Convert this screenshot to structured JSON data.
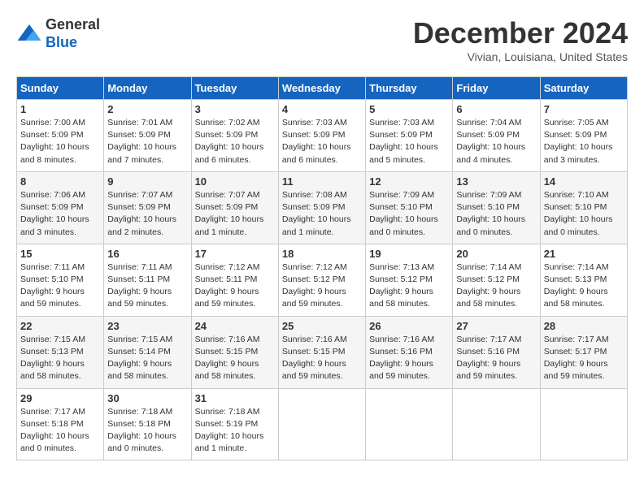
{
  "logo": {
    "general": "General",
    "blue": "Blue"
  },
  "title": "December 2024",
  "location": "Vivian, Louisiana, United States",
  "days_of_week": [
    "Sunday",
    "Monday",
    "Tuesday",
    "Wednesday",
    "Thursday",
    "Friday",
    "Saturday"
  ],
  "weeks": [
    [
      {
        "day": "1",
        "sunrise": "7:00 AM",
        "sunset": "5:09 PM",
        "daylight": "10 hours and 8 minutes."
      },
      {
        "day": "2",
        "sunrise": "7:01 AM",
        "sunset": "5:09 PM",
        "daylight": "10 hours and 7 minutes."
      },
      {
        "day": "3",
        "sunrise": "7:02 AM",
        "sunset": "5:09 PM",
        "daylight": "10 hours and 6 minutes."
      },
      {
        "day": "4",
        "sunrise": "7:03 AM",
        "sunset": "5:09 PM",
        "daylight": "10 hours and 6 minutes."
      },
      {
        "day": "5",
        "sunrise": "7:03 AM",
        "sunset": "5:09 PM",
        "daylight": "10 hours and 5 minutes."
      },
      {
        "day": "6",
        "sunrise": "7:04 AM",
        "sunset": "5:09 PM",
        "daylight": "10 hours and 4 minutes."
      },
      {
        "day": "7",
        "sunrise": "7:05 AM",
        "sunset": "5:09 PM",
        "daylight": "10 hours and 3 minutes."
      }
    ],
    [
      {
        "day": "8",
        "sunrise": "7:06 AM",
        "sunset": "5:09 PM",
        "daylight": "10 hours and 3 minutes."
      },
      {
        "day": "9",
        "sunrise": "7:07 AM",
        "sunset": "5:09 PM",
        "daylight": "10 hours and 2 minutes."
      },
      {
        "day": "10",
        "sunrise": "7:07 AM",
        "sunset": "5:09 PM",
        "daylight": "10 hours and 1 minute."
      },
      {
        "day": "11",
        "sunrise": "7:08 AM",
        "sunset": "5:09 PM",
        "daylight": "10 hours and 1 minute."
      },
      {
        "day": "12",
        "sunrise": "7:09 AM",
        "sunset": "5:10 PM",
        "daylight": "10 hours and 0 minutes."
      },
      {
        "day": "13",
        "sunrise": "7:09 AM",
        "sunset": "5:10 PM",
        "daylight": "10 hours and 0 minutes."
      },
      {
        "day": "14",
        "sunrise": "7:10 AM",
        "sunset": "5:10 PM",
        "daylight": "10 hours and 0 minutes."
      }
    ],
    [
      {
        "day": "15",
        "sunrise": "7:11 AM",
        "sunset": "5:10 PM",
        "daylight": "9 hours and 59 minutes."
      },
      {
        "day": "16",
        "sunrise": "7:11 AM",
        "sunset": "5:11 PM",
        "daylight": "9 hours and 59 minutes."
      },
      {
        "day": "17",
        "sunrise": "7:12 AM",
        "sunset": "5:11 PM",
        "daylight": "9 hours and 59 minutes."
      },
      {
        "day": "18",
        "sunrise": "7:12 AM",
        "sunset": "5:12 PM",
        "daylight": "9 hours and 59 minutes."
      },
      {
        "day": "19",
        "sunrise": "7:13 AM",
        "sunset": "5:12 PM",
        "daylight": "9 hours and 58 minutes."
      },
      {
        "day": "20",
        "sunrise": "7:14 AM",
        "sunset": "5:12 PM",
        "daylight": "9 hours and 58 minutes."
      },
      {
        "day": "21",
        "sunrise": "7:14 AM",
        "sunset": "5:13 PM",
        "daylight": "9 hours and 58 minutes."
      }
    ],
    [
      {
        "day": "22",
        "sunrise": "7:15 AM",
        "sunset": "5:13 PM",
        "daylight": "9 hours and 58 minutes."
      },
      {
        "day": "23",
        "sunrise": "7:15 AM",
        "sunset": "5:14 PM",
        "daylight": "9 hours and 58 minutes."
      },
      {
        "day": "24",
        "sunrise": "7:16 AM",
        "sunset": "5:15 PM",
        "daylight": "9 hours and 58 minutes."
      },
      {
        "day": "25",
        "sunrise": "7:16 AM",
        "sunset": "5:15 PM",
        "daylight": "9 hours and 59 minutes."
      },
      {
        "day": "26",
        "sunrise": "7:16 AM",
        "sunset": "5:16 PM",
        "daylight": "9 hours and 59 minutes."
      },
      {
        "day": "27",
        "sunrise": "7:17 AM",
        "sunset": "5:16 PM",
        "daylight": "9 hours and 59 minutes."
      },
      {
        "day": "28",
        "sunrise": "7:17 AM",
        "sunset": "5:17 PM",
        "daylight": "9 hours and 59 minutes."
      }
    ],
    [
      {
        "day": "29",
        "sunrise": "7:17 AM",
        "sunset": "5:18 PM",
        "daylight": "10 hours and 0 minutes."
      },
      {
        "day": "30",
        "sunrise": "7:18 AM",
        "sunset": "5:18 PM",
        "daylight": "10 hours and 0 minutes."
      },
      {
        "day": "31",
        "sunrise": "7:18 AM",
        "sunset": "5:19 PM",
        "daylight": "10 hours and 1 minute."
      },
      null,
      null,
      null,
      null
    ]
  ]
}
